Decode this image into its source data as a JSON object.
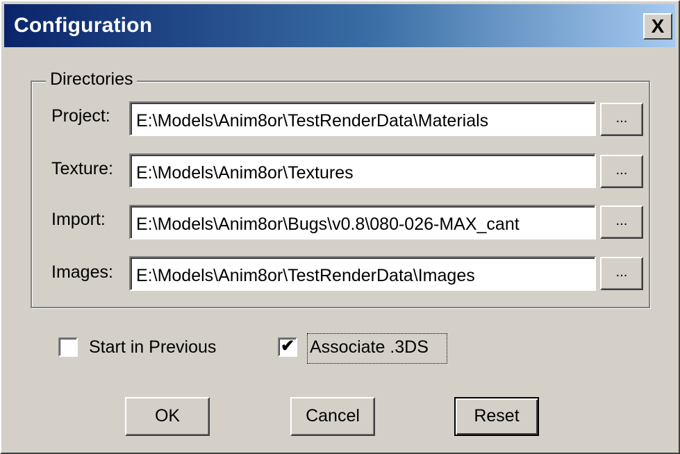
{
  "window": {
    "title": "Configuration",
    "close_label": "X"
  },
  "directories": {
    "group_label": "Directories",
    "browse_label": "...",
    "rows": [
      {
        "label": "Project:",
        "value": "E:\\Models\\Anim8or\\TestRenderData\\Materials"
      },
      {
        "label": "Texture:",
        "value": "E:\\Models\\Anim8or\\Textures"
      },
      {
        "label": "Import:",
        "value": "E:\\Models\\Anim8or\\Bugs\\v0.8\\080-026-MAX_cant"
      },
      {
        "label": "Images:",
        "value": "E:\\Models\\Anim8or\\TestRenderData\\Images"
      }
    ]
  },
  "options": {
    "start_in_previous": {
      "label": "Start in Previous",
      "checked": false
    },
    "associate_3ds": {
      "label": "Associate .3DS",
      "checked": true
    }
  },
  "buttons": {
    "ok": "OK",
    "cancel": "Cancel",
    "reset": "Reset"
  },
  "colors": {
    "title_gradient_start": "#0a246a",
    "title_gradient_end": "#a6caf0",
    "dialog_face": "#d4d0c8"
  }
}
